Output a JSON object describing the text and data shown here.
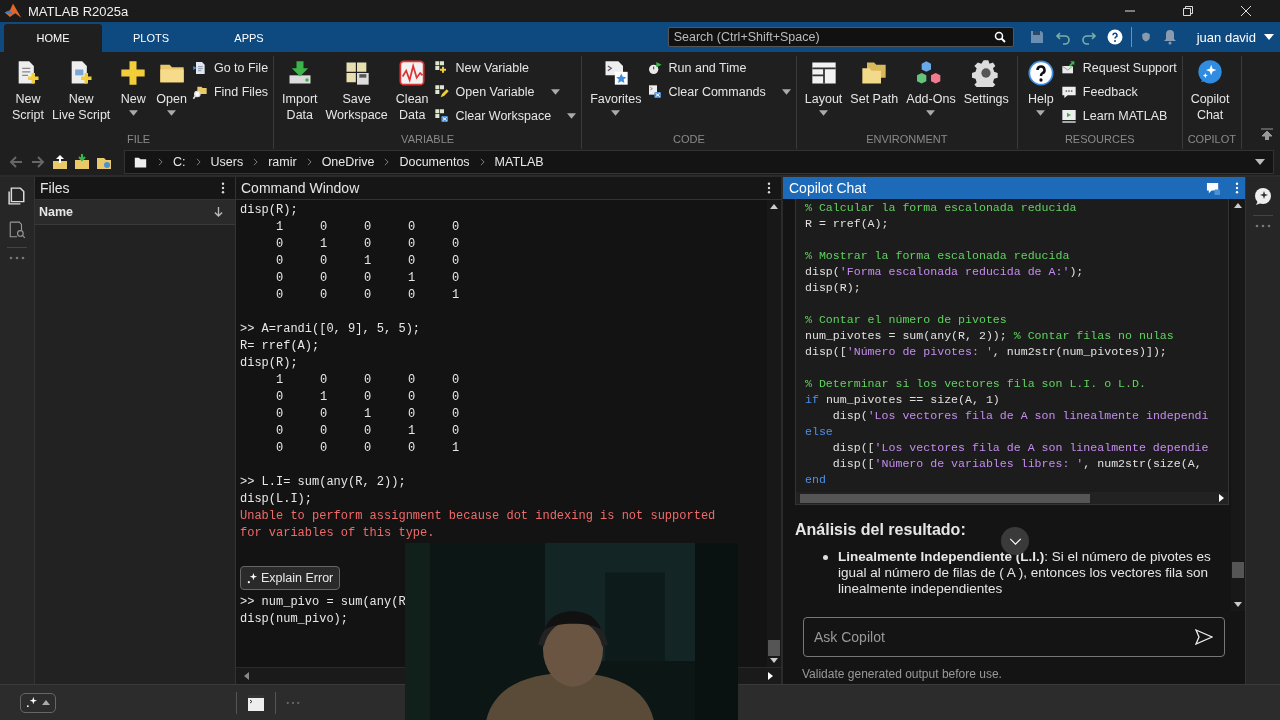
{
  "window": {
    "title": "MATLAB R2025a"
  },
  "tabs": [
    {
      "label": "HOME",
      "selected": true
    },
    {
      "label": "PLOTS",
      "selected": false
    },
    {
      "label": "APPS",
      "selected": false
    }
  ],
  "search": {
    "placeholder": "Search (Ctrl+Shift+Space)"
  },
  "user": {
    "name": "juan david"
  },
  "ribbon": [
    {
      "title": "FILE",
      "items": [
        {
          "kind": "large",
          "label": "New\nScript",
          "dropdown": false
        },
        {
          "kind": "large",
          "label": "New\nLive Script",
          "dropdown": false
        },
        {
          "kind": "large",
          "label": "New",
          "dropdown": true
        },
        {
          "kind": "large",
          "label": "Open",
          "dropdown": true
        },
        {
          "kind": "stack",
          "items": [
            {
              "label": "Go to File",
              "dropdown": false
            },
            {
              "label": "Find Files",
              "dropdown": false
            }
          ]
        }
      ]
    },
    {
      "title": "VARIABLE",
      "items": [
        {
          "kind": "large",
          "label": "Import\nData",
          "dropdown": false
        },
        {
          "kind": "large",
          "label": "Save\nWorkspace",
          "dropdown": false
        },
        {
          "kind": "large",
          "label": "Clean\nData",
          "dropdown": false
        },
        {
          "kind": "stack",
          "items": [
            {
              "label": "New Variable",
              "dropdown": false
            },
            {
              "label": "Open Variable",
              "dropdown": true
            },
            {
              "label": "Clear Workspace",
              "dropdown": true
            }
          ]
        }
      ]
    },
    {
      "title": "CODE",
      "items": [
        {
          "kind": "large",
          "label": "Favorites",
          "dropdown": true
        },
        {
          "kind": "stack",
          "items": [
            {
              "label": "Run and Time",
              "dropdown": false
            },
            {
              "label": "Clear Commands",
              "dropdown": true
            }
          ]
        }
      ]
    },
    {
      "title": "ENVIRONMENT",
      "items": [
        {
          "kind": "large",
          "label": "Layout",
          "dropdown": true
        },
        {
          "kind": "large",
          "label": "Set Path",
          "dropdown": false
        },
        {
          "kind": "large",
          "label": "Add-Ons",
          "dropdown": true
        },
        {
          "kind": "large",
          "label": "Settings",
          "dropdown": false
        }
      ]
    },
    {
      "title": "RESOURCES",
      "items": [
        {
          "kind": "large",
          "label": "Help",
          "dropdown": true
        },
        {
          "kind": "stack",
          "items": [
            {
              "label": "Request Support",
              "dropdown": false
            },
            {
              "label": "Feedback",
              "dropdown": false
            },
            {
              "label": "Learn MATLAB",
              "dropdown": false
            }
          ]
        }
      ]
    },
    {
      "title": "COPILOT",
      "items": [
        {
          "kind": "large",
          "label": "Copilot\nChat",
          "dropdown": false
        }
      ]
    }
  ],
  "address_bar": {
    "path": [
      "C:",
      "Users",
      "ramir",
      "OneDrive",
      "Documentos",
      "MATLAB"
    ]
  },
  "files_panel": {
    "title": "Files",
    "columns": [
      "Name"
    ]
  },
  "command_window": {
    "title": "Command Window",
    "lines": [
      {
        "kind": "input",
        "text": "disp(R);"
      },
      {
        "kind": "matrix",
        "cells": [
          "1",
          "0",
          "0",
          "0",
          "0"
        ]
      },
      {
        "kind": "matrix",
        "cells": [
          "0",
          "1",
          "0",
          "0",
          "0"
        ]
      },
      {
        "kind": "matrix",
        "cells": [
          "0",
          "0",
          "1",
          "0",
          "0"
        ]
      },
      {
        "kind": "matrix",
        "cells": [
          "0",
          "0",
          "0",
          "1",
          "0"
        ]
      },
      {
        "kind": "matrix",
        "cells": [
          "0",
          "0",
          "0",
          "0",
          "1"
        ]
      },
      {
        "kind": "blank"
      },
      {
        "kind": "input",
        "text": ">> A=randi([0, 9], 5, 5);"
      },
      {
        "kind": "input",
        "text": "R= rref(A);"
      },
      {
        "kind": "input",
        "text": "disp(R);"
      },
      {
        "kind": "matrix",
        "cells": [
          "1",
          "0",
          "0",
          "0",
          "0"
        ]
      },
      {
        "kind": "matrix",
        "cells": [
          "0",
          "1",
          "0",
          "0",
          "0"
        ]
      },
      {
        "kind": "matrix",
        "cells": [
          "0",
          "0",
          "1",
          "0",
          "0"
        ]
      },
      {
        "kind": "matrix",
        "cells": [
          "0",
          "0",
          "0",
          "1",
          "0"
        ]
      },
      {
        "kind": "matrix",
        "cells": [
          "0",
          "0",
          "0",
          "0",
          "1"
        ]
      },
      {
        "kind": "blank"
      },
      {
        "kind": "input",
        "text": ">> L.I= sum(any(R, 2));"
      },
      {
        "kind": "input",
        "text": "disp(L.I);"
      },
      {
        "kind": "error",
        "text": "Unable to perform assignment because dot indexing is not supported"
      },
      {
        "kind": "error",
        "text": "for variables of this type."
      },
      {
        "kind": "blank"
      },
      {
        "kind": "button",
        "text": "Explain Error"
      },
      {
        "kind": "input",
        "text": ">> num_pivo = sum(any(R"
      },
      {
        "kind": "input",
        "text": "disp(num_pivo);"
      }
    ]
  },
  "copilot_chat": {
    "title": "Copilot Chat",
    "code_lines": [
      {
        "kind": "code",
        "segments": [
          {
            "kind": "comment",
            "text": "% Calcular la forma escalonada reducida"
          }
        ]
      },
      {
        "kind": "code",
        "segments": [
          {
            "kind": "plain",
            "text": "R = rref(A);"
          }
        ]
      },
      {
        "kind": "blank"
      },
      {
        "kind": "code",
        "segments": [
          {
            "kind": "comment",
            "text": "% Mostrar la forma escalonada reducida"
          }
        ]
      },
      {
        "kind": "code",
        "segments": [
          {
            "kind": "plain",
            "text": "disp("
          },
          {
            "kind": "string",
            "text": "'Forma escalonada reducida de A:'"
          },
          {
            "kind": "plain",
            "text": ");"
          }
        ]
      },
      {
        "kind": "code",
        "segments": [
          {
            "kind": "plain",
            "text": "disp(R);"
          }
        ]
      },
      {
        "kind": "blank"
      },
      {
        "kind": "code",
        "segments": [
          {
            "kind": "comment",
            "text": "% Contar el número de pivotes"
          }
        ]
      },
      {
        "kind": "code",
        "segments": [
          {
            "kind": "plain",
            "text": "num_pivotes = sum(any(R, 2)); "
          },
          {
            "kind": "comment",
            "text": "% Contar filas no nulas"
          }
        ]
      },
      {
        "kind": "code",
        "segments": [
          {
            "kind": "plain",
            "text": "disp(["
          },
          {
            "kind": "string",
            "text": "'Número de pivotes: '"
          },
          {
            "kind": "plain",
            "text": ", num2str(num_pivotes)]);"
          }
        ]
      },
      {
        "kind": "blank"
      },
      {
        "kind": "code",
        "segments": [
          {
            "kind": "comment",
            "text": "% Determinar si los vectores fila son L.I. o L.D."
          }
        ]
      },
      {
        "kind": "code",
        "segments": [
          {
            "kind": "keyword",
            "text": "if"
          },
          {
            "kind": "plain",
            "text": " num_pivotes == size(A, 1)"
          }
        ]
      },
      {
        "kind": "code",
        "segments": [
          {
            "kind": "plain",
            "text": "    disp("
          },
          {
            "kind": "string",
            "text": "'Los vectores fila de A son linealmente independi"
          }
        ]
      },
      {
        "kind": "code",
        "segments": [
          {
            "kind": "keyword",
            "text": "else"
          }
        ]
      },
      {
        "kind": "code",
        "segments": [
          {
            "kind": "plain",
            "text": "    disp(["
          },
          {
            "kind": "string",
            "text": "'Los vectores fila de A son linealmente dependie"
          }
        ]
      },
      {
        "kind": "code",
        "segments": [
          {
            "kind": "plain",
            "text": "    disp(["
          },
          {
            "kind": "string",
            "text": "'Número de variables libres: '"
          },
          {
            "kind": "plain",
            "text": ", num2str(size(A,"
          }
        ]
      },
      {
        "kind": "code",
        "segments": [
          {
            "kind": "keyword",
            "text": "end"
          }
        ]
      }
    ],
    "heading": "Análisis del resultado:",
    "bullets": [
      "**Linealmente Independiente (L.I.)**: Si el número de pivotes es igual al número de filas de ( A ), entonces los vectores fila son linealmente independientes"
    ],
    "input": {
      "placeholder": "Ask Copilot"
    },
    "disclaimer": "Validate generated output before use."
  }
}
